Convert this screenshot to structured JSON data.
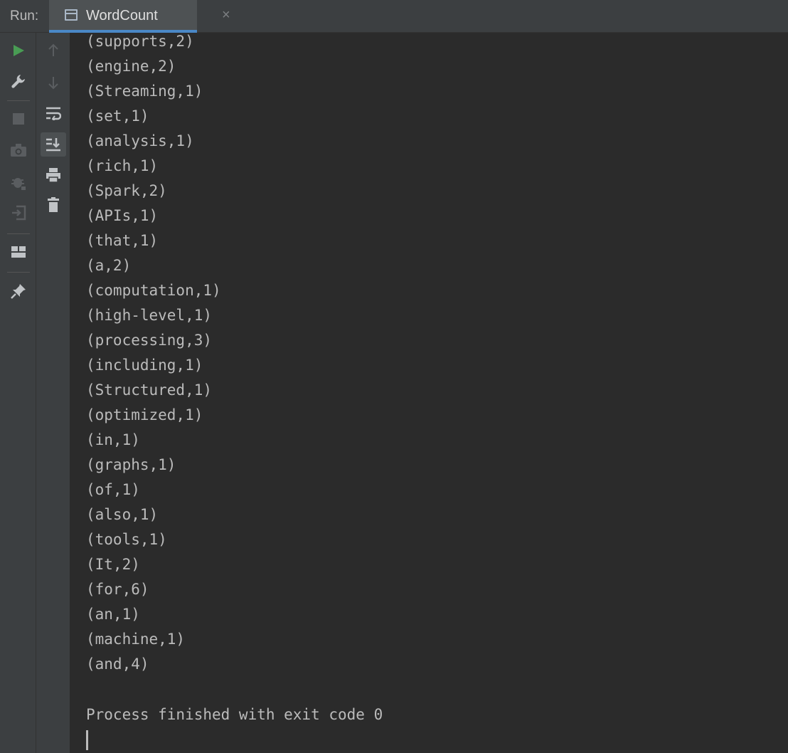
{
  "header": {
    "run_label": "Run:",
    "tab_title": "WordCount",
    "tab_close": "×"
  },
  "toolbar": {
    "primary_icons": [
      "rerun-icon",
      "wrench-icon",
      "stop-icon",
      "camera-icon",
      "debug-icon",
      "exit-icon",
      "layout-icon",
      "pin-icon"
    ],
    "secondary_icons": [
      "up-arrow-icon",
      "down-arrow-icon",
      "soft-wrap-icon",
      "scroll-to-end-icon",
      "print-icon",
      "trash-icon"
    ]
  },
  "colors": {
    "accent": "#4a88c7",
    "run_green": "#499c54",
    "console_text": "#bbbbbb",
    "console_bg": "#2b2b2b"
  },
  "console": {
    "lines": [
      "(supports,2)",
      "(engine,2)",
      "(Streaming,1)",
      "(set,1)",
      "(analysis,1)",
      "(rich,1)",
      "(Spark,2)",
      "(APIs,1)",
      "(that,1)",
      "(a,2)",
      "(computation,1)",
      "(high-level,1)",
      "(processing,3)",
      "(including,1)",
      "(Structured,1)",
      "(optimized,1)",
      "(in,1)",
      "(graphs,1)",
      "(of,1)",
      "(also,1)",
      "(tools,1)",
      "(It,2)",
      "(for,6)",
      "(an,1)",
      "(machine,1)",
      "(and,4)"
    ],
    "finish_message": "Process finished with exit code 0"
  }
}
